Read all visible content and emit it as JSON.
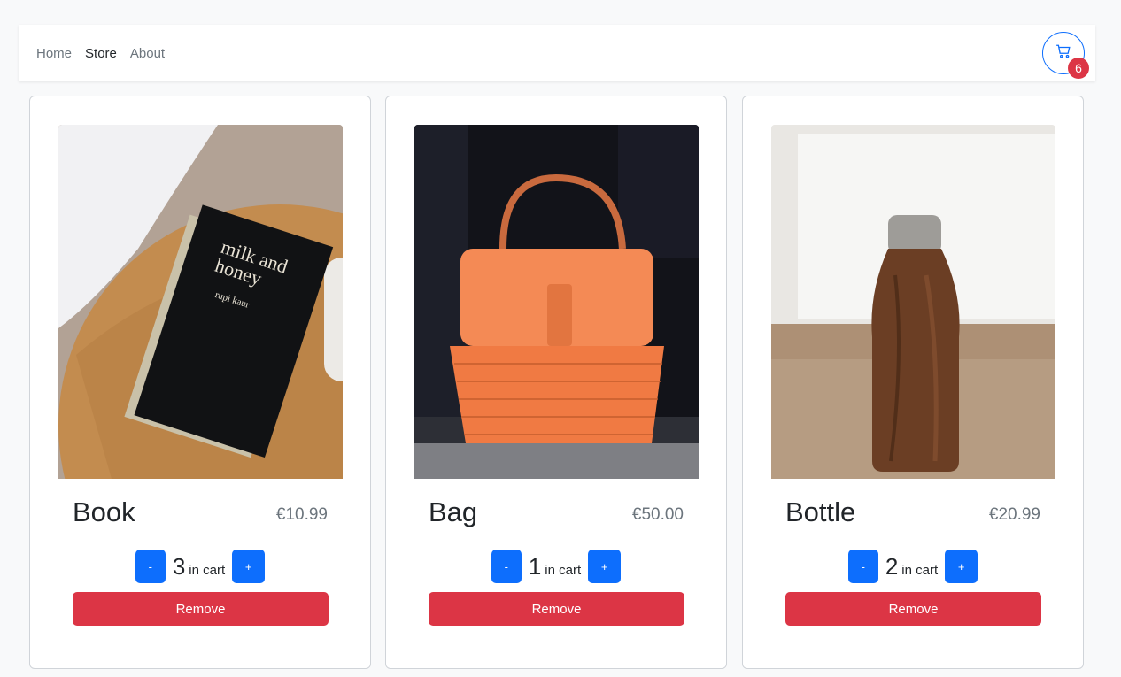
{
  "nav": {
    "links": [
      {
        "label": "Home"
      },
      {
        "label": "Store"
      },
      {
        "label": "About"
      }
    ],
    "cart_count": "6",
    "cart_icon": "cart-icon"
  },
  "colors": {
    "primary": "#0d6efd",
    "danger": "#dc3545",
    "muted": "#6c757d"
  },
  "products": [
    {
      "name": "Book",
      "price": "€10.99",
      "quantity": "3",
      "in_cart_label": "in cart",
      "minus": "-",
      "plus": "+",
      "remove": "Remove",
      "image": "book-photo"
    },
    {
      "name": "Bag",
      "price": "€50.00",
      "quantity": "1",
      "in_cart_label": "in cart",
      "minus": "-",
      "plus": "+",
      "remove": "Remove",
      "image": "bag-photo"
    },
    {
      "name": "Bottle",
      "price": "€20.99",
      "quantity": "2",
      "in_cart_label": "in cart",
      "minus": "-",
      "plus": "+",
      "remove": "Remove",
      "image": "bottle-photo"
    }
  ]
}
